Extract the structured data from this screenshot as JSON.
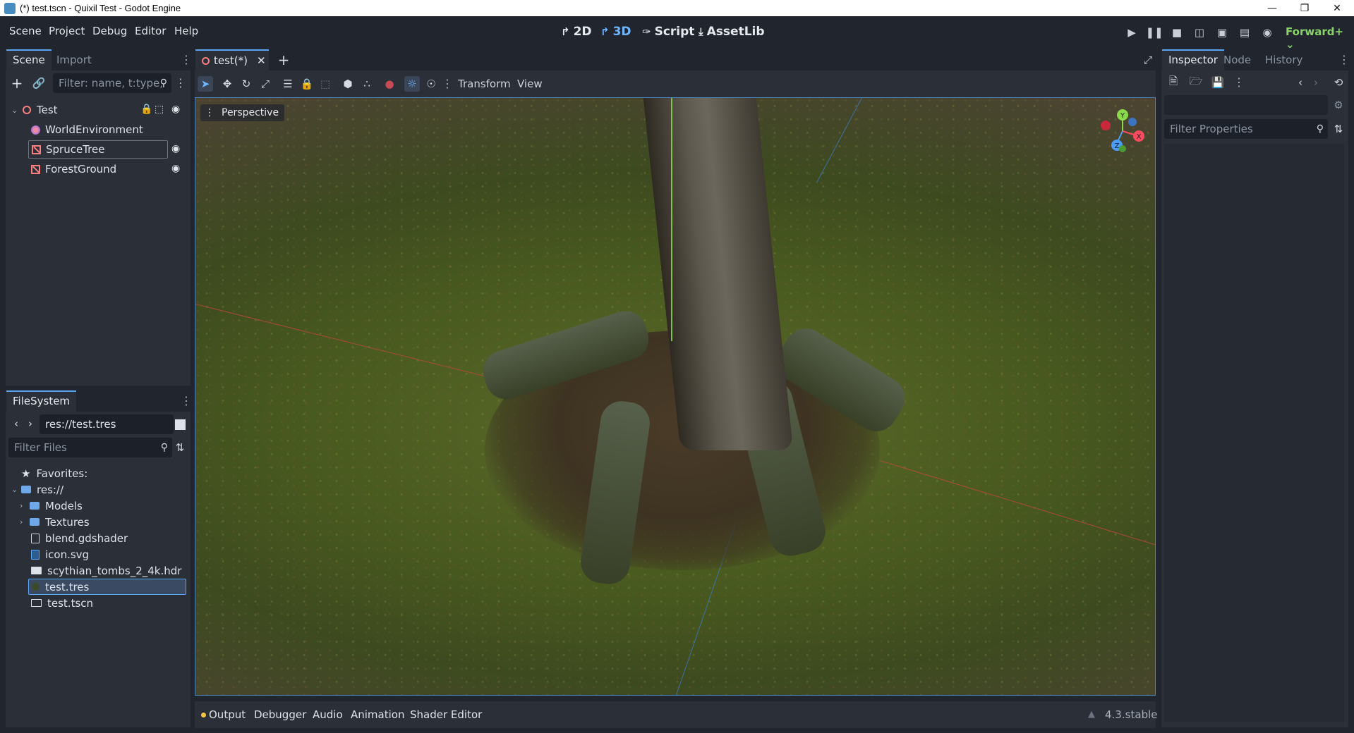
{
  "window": {
    "title": "(*) test.tscn - Quixil Test - Godot Engine"
  },
  "menu": {
    "items": [
      "Scene",
      "Project",
      "Debug",
      "Editor",
      "Help"
    ]
  },
  "workspaces": {
    "btn_2d": "2D",
    "btn_3d": "3D",
    "btn_script": "Script",
    "btn_assetlib": "AssetLib"
  },
  "renderer": "Forward+",
  "scene_dock": {
    "tabs": [
      "Scene",
      "Import"
    ],
    "filter_placeholder": "Filter: name, t:type,",
    "nodes": [
      {
        "name": "Test",
        "icon": "node3d-icon"
      },
      {
        "name": "WorldEnvironment",
        "icon": "world-environment-icon"
      },
      {
        "name": "SpruceTree",
        "icon": "mesh-instance-icon"
      },
      {
        "name": "ForestGround",
        "icon": "mesh-instance-icon"
      }
    ]
  },
  "filesystem": {
    "tab": "FileSystem",
    "path": "res://test.tres",
    "filter_placeholder": "Filter Files",
    "favorites": "Favorites:",
    "items": [
      {
        "name": "res://",
        "type": "folder"
      },
      {
        "name": "Models",
        "type": "folder"
      },
      {
        "name": "Textures",
        "type": "folder"
      },
      {
        "name": "blend.gdshader",
        "type": "file"
      },
      {
        "name": "icon.svg",
        "type": "file"
      },
      {
        "name": "scythian_tombs_2_4k.hdr",
        "type": "file"
      },
      {
        "name": "test.tres",
        "type": "file",
        "selected": true
      },
      {
        "name": "test.tscn",
        "type": "file"
      }
    ]
  },
  "editor_tabs": {
    "current": "test(*)"
  },
  "viewport_toolbar": {
    "transform": "Transform",
    "view": "View"
  },
  "viewport": {
    "perspective": "Perspective",
    "gizmo": {
      "x": "X",
      "y": "Y",
      "z": "Z"
    }
  },
  "inspector": {
    "tabs": [
      "Inspector",
      "Node",
      "History"
    ],
    "filter_placeholder": "Filter Properties"
  },
  "bottom_panel": {
    "tabs": [
      "Output",
      "Debugger",
      "Audio",
      "Animation",
      "Shader Editor"
    ],
    "version": "4.3.stable"
  },
  "colors": {
    "accent": "#5aa6f5",
    "renderer": "#8ad36b",
    "node_red": "#fc7f7f"
  }
}
